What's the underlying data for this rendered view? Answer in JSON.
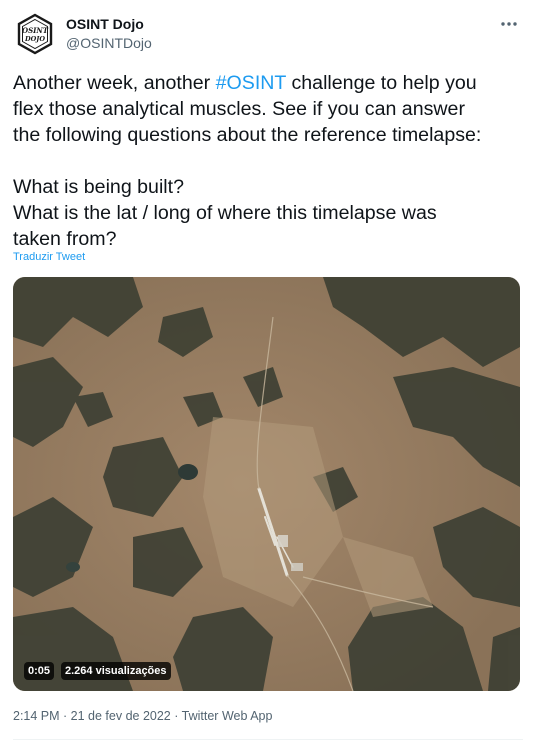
{
  "author": {
    "display_name": "OSINT Dojo",
    "handle": "@OSINTDojo",
    "avatar_text_top": "OSINT",
    "avatar_text_bottom": "DOJO"
  },
  "tweet": {
    "text_line1_before": "Another week, another ",
    "hashtag": "#OSINT",
    "text_line1_after": " challenge to help you",
    "text_line2": "flex those analytical muscles. See if you can answer",
    "text_line3": "the following questions about the reference timelapse:",
    "question1": "What is being built?",
    "question2_line1": "What is the lat / long of where this timelapse was",
    "question2_line2": "taken from?",
    "translate_label": "Traduzir Tweet"
  },
  "video": {
    "duration": "0:05",
    "views": "2.264 visualizações"
  },
  "meta": {
    "time": "2:14 PM",
    "separator": " · ",
    "date": "21 de fev de 2022",
    "source": "Twitter Web App"
  },
  "colors": {
    "accent": "#1d9bf0",
    "text": "#0f1419",
    "secondary": "#536471"
  },
  "icons": {
    "more": "more-horizontal-icon",
    "avatar": "osint-dojo-logo"
  }
}
